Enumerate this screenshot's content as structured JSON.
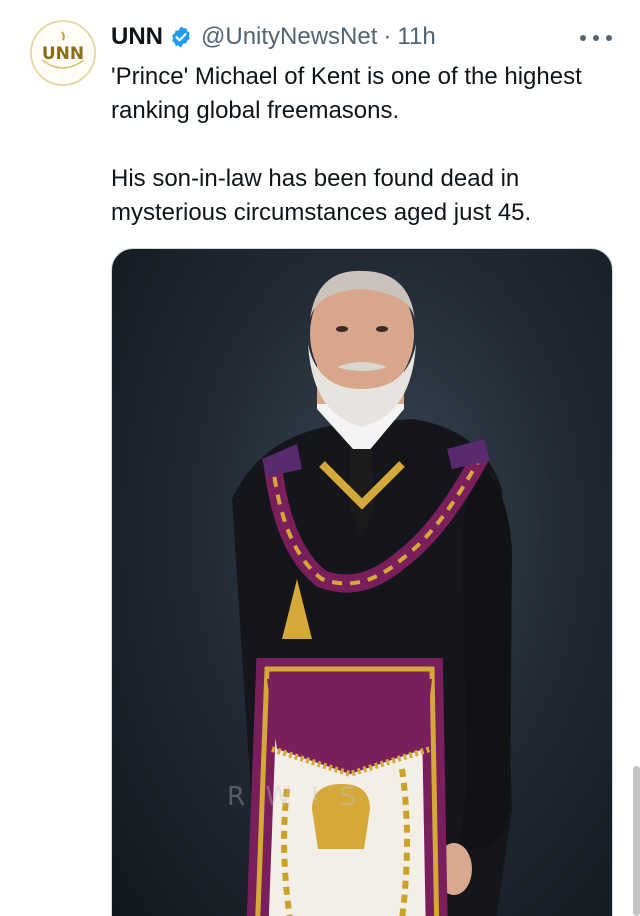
{
  "tweet": {
    "display_name": "UNN",
    "handle": "@UnityNewsNet",
    "separator": "·",
    "time": "11h",
    "avatar_text": "UNN",
    "icons": {
      "verified": "verified-badge-icon",
      "more": "more-options-icon"
    },
    "text_paragraphs": [
      "'Prince' Michael of Kent is one of the highest ranking global freemasons.",
      "His son-in-law has been found dead in mysterious circumstances aged just 45."
    ],
    "image": {
      "watermark": "R          W I S"
    }
  },
  "colors": {
    "verified": "#1d9bf0",
    "secondary_text": "#536471",
    "avatar_gold": "#c9a227",
    "regalia_purple": "#7a1f5c",
    "regalia_gold": "#d4a93a"
  }
}
